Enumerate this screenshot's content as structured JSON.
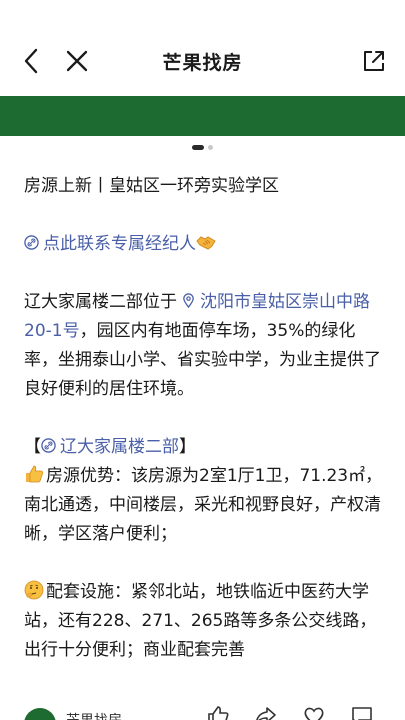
{
  "header": {
    "title": "芒果找房"
  },
  "banner": {
    "color": "#1e6b32"
  },
  "carousel": {
    "count": 2,
    "active": 0
  },
  "article": {
    "headline": "房源上新丨皇姑区一环旁实验学区",
    "contact_link": "点此联系专属经纪人",
    "intro_prefix": "辽大家属楼二部位于",
    "address_link": "沈阳市皇姑区崇山中路20-1号",
    "intro_suffix": "，园区内有地面停车场，35%的绿化率，坐拥泰山小学、省实验中学，为业主提供了良好便利的居住环境。",
    "bracket_open": "【",
    "community_link": "辽大家属楼二部",
    "bracket_close": "】",
    "advantage": "房源优势：该房源为2室1厅1卫，71.23㎡，南北通透，中间楼层，采光和视野良好，产权清晰，学区落户便利；",
    "facilities": "配套设施：紧邻北站，地铁临近中医药大学站，还有228、271、265路等多条公交线路，出行十分便利；商业配套完善"
  },
  "bottom": {
    "name": "芒果找房"
  },
  "icons": {
    "back": "chevron-left-icon",
    "close": "close-icon",
    "share": "share-icon",
    "link": "link-icon",
    "location": "location-pin-icon",
    "handshake": "handshake-emoji",
    "thumbsup": "thumbs-up-emoji",
    "thinking": "thinking-face-emoji"
  },
  "colors": {
    "accent": "#1e6b32",
    "link": "#4a5fa8"
  }
}
